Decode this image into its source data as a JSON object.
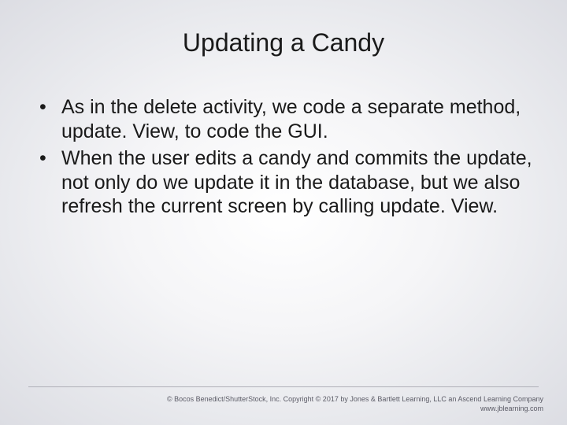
{
  "slide": {
    "title": "Updating a Candy",
    "bullets": [
      "As in the delete activity, we code a separate method, update. View, to code the GUI.",
      "When the user edits a candy and commits the update, not only do we update it in the database, but we also refresh the current screen by calling update. View."
    ]
  },
  "footer": {
    "line1": "© Bocos Benedict/ShutterStock, Inc. Copyright © 2017 by Jones & Bartlett Learning, LLC an Ascend Learning Company",
    "line2": "www.jblearning.com"
  }
}
